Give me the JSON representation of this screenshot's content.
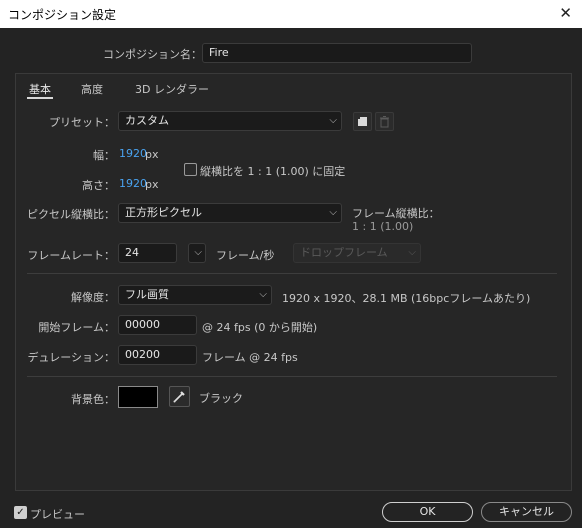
{
  "window": {
    "title": "コンポジション設定",
    "close_glyph": "✕"
  },
  "comp_name": {
    "label": "コンポジション名：",
    "value": "Fire"
  },
  "tabs": [
    {
      "label": "基本",
      "active": true
    },
    {
      "label": "高度",
      "active": false
    },
    {
      "label": "3D レンダラー",
      "active": false
    }
  ],
  "preset": {
    "label": "プリセット：",
    "value": "カスタム",
    "new_icon": "new-preset-icon",
    "delete_icon": "trash-icon"
  },
  "width": {
    "label": "幅：",
    "value": "1920",
    "unit": "px"
  },
  "height": {
    "label": "高さ：",
    "value": "1920",
    "unit": "px"
  },
  "lock_aspect": {
    "checked": false,
    "label": "縦横比を 1 : 1 (1.00) に固定"
  },
  "pixel_aspect": {
    "label": "ピクセル縦横比：",
    "value": "正方形ピクセル",
    "frame_aspect_label": "フレーム縦横比：",
    "frame_aspect_value": "1 : 1 (1.00)"
  },
  "frame_rate": {
    "label": "フレームレート：",
    "value": "24",
    "unit": "フレーム/秒",
    "dropframe": "ドロップフレーム"
  },
  "resolution": {
    "label": "解像度：",
    "value": "フル画質",
    "info": "1920 x 1920、28.1 MB (16bpcフレームあたり)"
  },
  "start_frame": {
    "label": "開始フレーム：",
    "value": "00000",
    "info": "@ 24 fps (0 から開始)"
  },
  "duration": {
    "label": "デュレーション：",
    "value": "00200",
    "info": "フレーム @ 24 fps"
  },
  "bg_color": {
    "label": "背景色：",
    "swatch": "#000000",
    "name": "ブラック"
  },
  "preview": {
    "checked": true,
    "label": "プレビュー"
  },
  "buttons": {
    "ok": "OK",
    "cancel": "キャンセル"
  }
}
